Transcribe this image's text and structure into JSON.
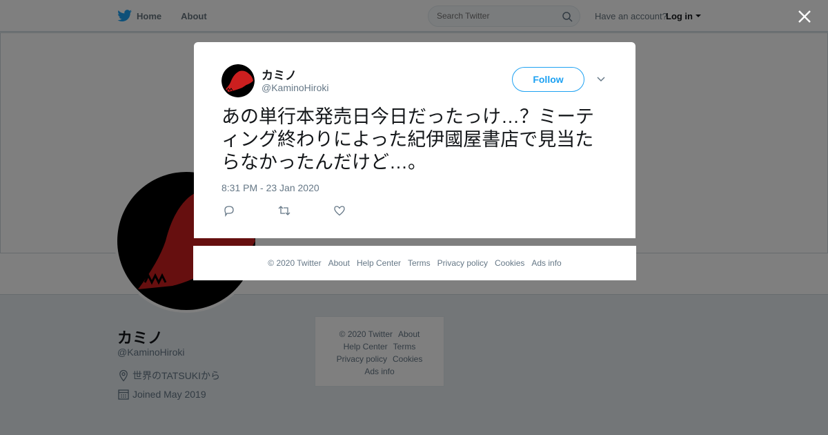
{
  "topbar": {
    "home_label": "Home",
    "about_label": "About",
    "search_placeholder": "Search Twitter",
    "account_prompt": "Have an account?",
    "login_label": "Log in"
  },
  "profile": {
    "name": "カミノ",
    "handle": "@KaminoHiroki",
    "location": "世界のTATSUKIから",
    "joined": "Joined May 2019"
  },
  "side_footer": {
    "row1": [
      "© 2020 Twitter",
      "About"
    ],
    "row2": [
      "Help Center",
      "Terms"
    ],
    "row3": [
      "Privacy policy",
      "Cookies"
    ],
    "row4": [
      "Ads info"
    ]
  },
  "tweet": {
    "name": "カミノ",
    "handle": "@KaminoHiroki",
    "follow_label": "Follow",
    "text": "あの単行本発売日今日だったっけ…？ミーティング終わりによった紀伊國屋書店で見当たらなかったんだけど…。",
    "timestamp": "8:31 PM - 23 Jan 2020"
  },
  "modal_footer": {
    "links": [
      "© 2020 Twitter",
      "About",
      "Help Center",
      "Terms",
      "Privacy policy",
      "Cookies",
      "Ads info"
    ]
  },
  "colors": {
    "accent": "#1da1f2",
    "avatar_red": "#cc1f1f",
    "avatar_black": "#000000"
  }
}
